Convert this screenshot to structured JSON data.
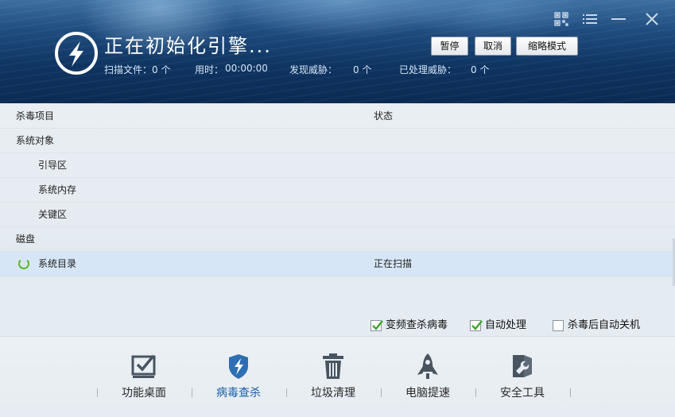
{
  "header": {
    "title": "正在初始化引擎...",
    "stats": [
      {
        "label": "扫描文件：",
        "value": "0 个"
      },
      {
        "label": "用时：",
        "value": "00:00:00"
      },
      {
        "label": "发现威胁：",
        "value": "0 个"
      },
      {
        "label": "已处理威胁：",
        "value": "0 个"
      }
    ],
    "buttons": {
      "pause": "暂停",
      "cancel": "取消",
      "compact": "缩略模式"
    },
    "window_controls": [
      "qr-code-icon",
      "menu-icon",
      "minimize-icon",
      "close-icon"
    ]
  },
  "list": {
    "columns": {
      "name": "杀毒项目",
      "status": "状态"
    },
    "rows": [
      {
        "name": "系统对象",
        "status": "",
        "indent": false
      },
      {
        "name": "引导区",
        "status": "",
        "indent": true
      },
      {
        "name": "系统内存",
        "status": "",
        "indent": true
      },
      {
        "name": "关键区",
        "status": "",
        "indent": true
      },
      {
        "name": "磁盘",
        "status": "",
        "indent": false
      },
      {
        "name": "系统目录",
        "status": "正在扫描",
        "indent": true,
        "active": true
      }
    ]
  },
  "options": [
    {
      "label": "变频查杀病毒",
      "checked": true
    },
    {
      "label": "自动处理",
      "checked": true
    },
    {
      "label": "杀毒后自动关机",
      "checked": false
    }
  ],
  "toolbar": {
    "items": [
      {
        "label": "功能桌面",
        "icon": "desktop-check-icon"
      },
      {
        "label": "病毒查杀",
        "icon": "shield-bolt-icon",
        "active": true
      },
      {
        "label": "垃圾清理",
        "icon": "trash-icon"
      },
      {
        "label": "电脑提速",
        "icon": "rocket-icon"
      },
      {
        "label": "安全工具",
        "icon": "toolbox-icon"
      }
    ]
  },
  "colors": {
    "header_dark": "#0a2a52",
    "active_row": "#d7e6f6",
    "check_green": "#3aa52a",
    "spinner_green": "#5cb82d",
    "active_tab_blue": "#1a5fa5"
  }
}
